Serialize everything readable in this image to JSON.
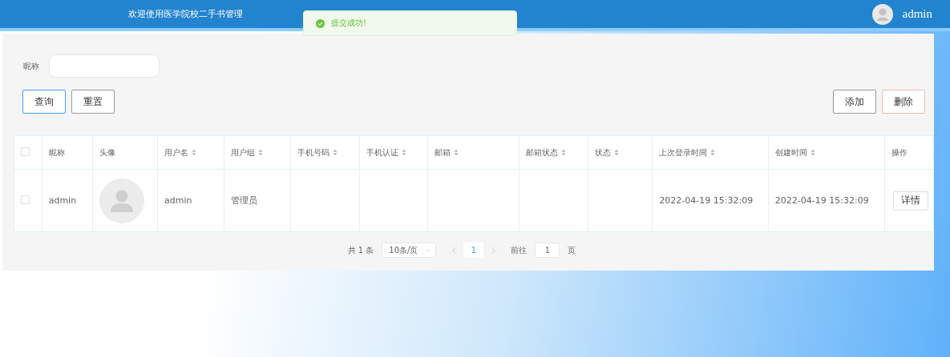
{
  "header": {
    "title": "欢迎使用医学院校二手书管理",
    "user": "admin"
  },
  "toast": {
    "message": "提交成功!",
    "kind": "success"
  },
  "search": {
    "label": "昵称"
  },
  "search_buttons": [
    {
      "label": "查询",
      "kind": "primary"
    },
    {
      "label": "重置",
      "kind": "plain"
    }
  ],
  "action_buttons": [
    {
      "label": "添加",
      "kind": "plain"
    },
    {
      "label": "删除",
      "kind": "danger"
    }
  ],
  "table": {
    "all_checked": false,
    "columns": [
      {
        "label": "昵称",
        "sortable": false
      },
      {
        "label": "头像",
        "sortable": false
      },
      {
        "label": "用户名",
        "sortable": true
      },
      {
        "label": "用户组",
        "sortable": true
      },
      {
        "label": "手机号码",
        "sortable": true
      },
      {
        "label": "手机认证",
        "sortable": true
      },
      {
        "label": "邮箱",
        "sortable": true
      },
      {
        "label": "邮箱状态",
        "sortable": true
      },
      {
        "label": "状态",
        "sortable": true
      },
      {
        "label": "上次登录时间",
        "sortable": true
      },
      {
        "label": "创建时间",
        "sortable": true
      },
      {
        "label": "操作",
        "sortable": false
      }
    ],
    "rows": [
      {
        "checked": false,
        "cells": [
          {
            "kind": "text",
            "text": "admin"
          },
          {
            "kind": "avatar"
          },
          {
            "kind": "text",
            "text": "admin"
          },
          {
            "kind": "text",
            "text": "管理员"
          },
          {
            "kind": "text",
            "text": ""
          },
          {
            "kind": "text",
            "text": ""
          },
          {
            "kind": "text",
            "text": ""
          },
          {
            "kind": "text",
            "text": ""
          },
          {
            "kind": "text",
            "text": ""
          },
          {
            "kind": "text",
            "text": "2022-04-19 15:32:09"
          },
          {
            "kind": "text",
            "text": "2022-04-19 15:32:09"
          },
          {
            "kind": "button",
            "text": "详情"
          }
        ]
      }
    ]
  },
  "pagination": {
    "total": "共 1 条",
    "page_size": "10条/页",
    "pages": [
      {
        "label": "1",
        "selected": true
      }
    ],
    "goto_label": "前往",
    "goto_value": "1",
    "goto_suffix": "页"
  }
}
